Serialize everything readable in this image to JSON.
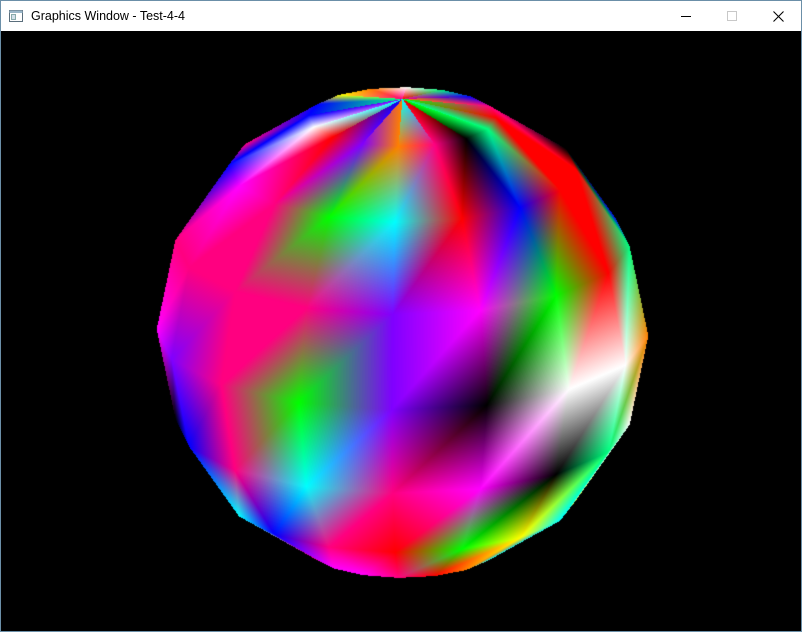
{
  "window": {
    "title": "Graphics Window - Test-4-4"
  },
  "title_bar": {
    "icons": {
      "app": "app-window-icon",
      "minimize": "minimize-icon",
      "maximize": "maximize-icon",
      "close": "close-icon"
    }
  },
  "viewport": {
    "background": "#000000",
    "content": "3D sphere rendered with per-vertex RGB gradient shading"
  },
  "colors": {
    "accent_border": "#6b8fa8",
    "titlebar_bg": "#ffffff"
  }
}
